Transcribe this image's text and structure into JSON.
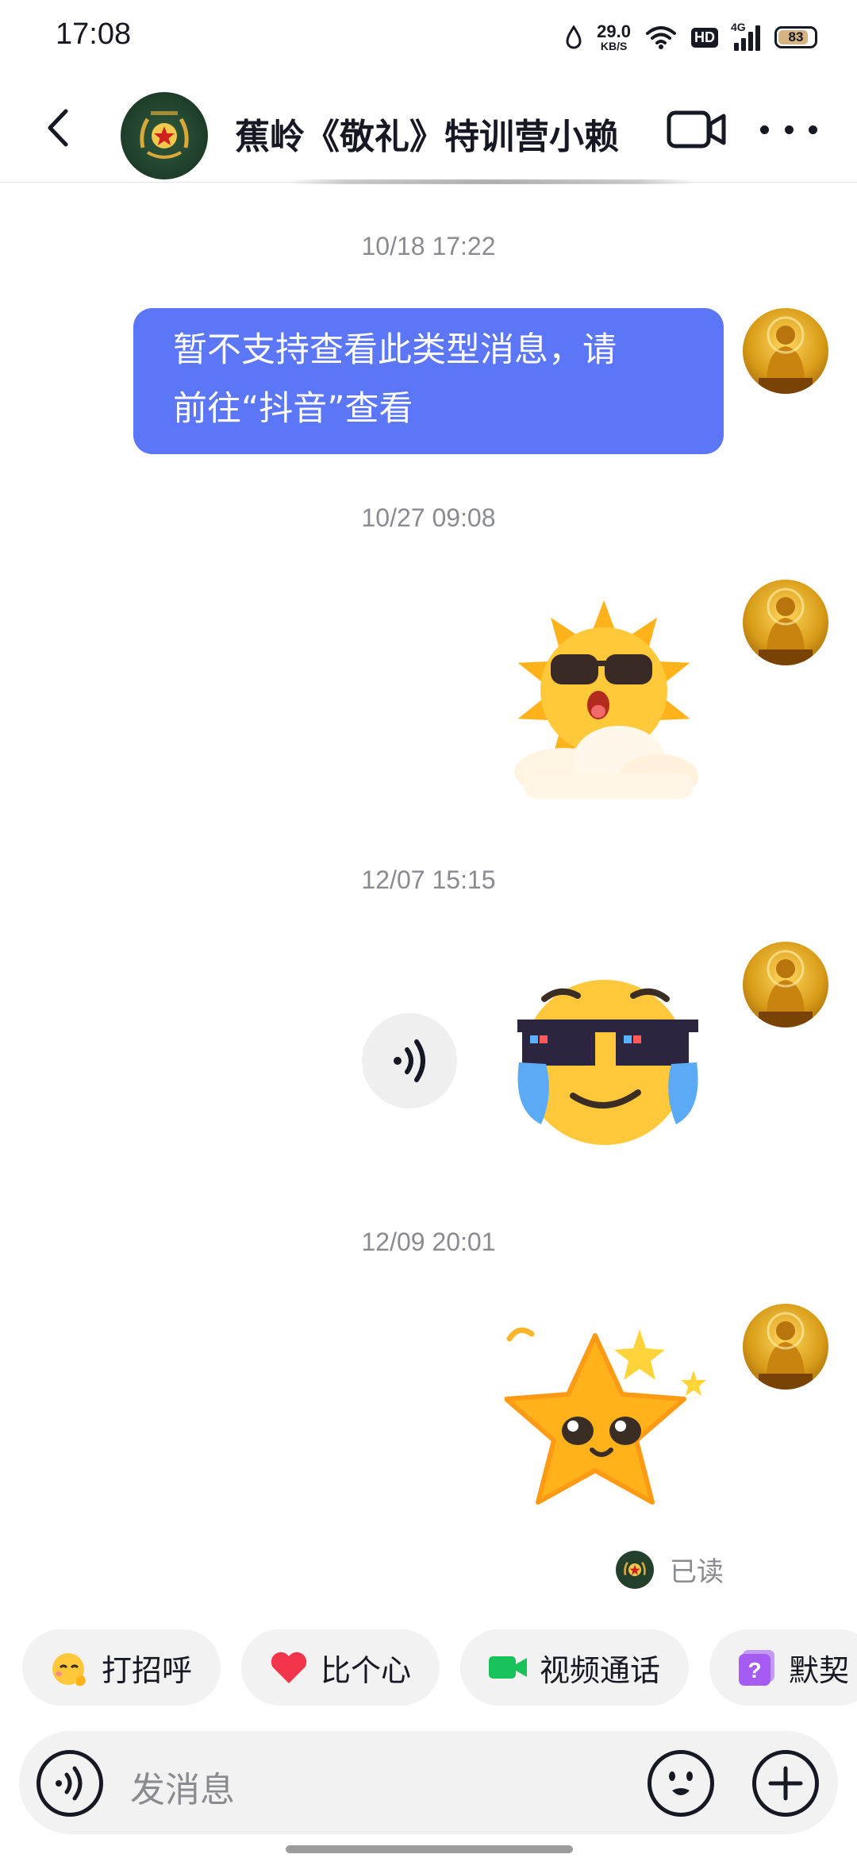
{
  "status_bar": {
    "time": "17:08",
    "net_speed_value": "29.0",
    "net_speed_unit": "KB/S",
    "hd_label": "HD",
    "signal_label": "4G",
    "battery_level": "83"
  },
  "header": {
    "title": "蕉岭《敬礼》特训营小赖",
    "back_icon": "chevron-left-icon",
    "video_icon": "video-camera-icon",
    "more_icon": "more-dots-icon"
  },
  "messages": {
    "ts1": "10/18 17:22",
    "bubble_line1": "暂不支持查看此类型消息，请",
    "bubble_line2": "前往“抖音”查看",
    "ts2": "10/27 09:08",
    "sticker1": "sun-sunglasses-sticker",
    "ts3": "12/07 15:15",
    "sticker2": "crying-cool-face-sticker",
    "ts4": "12/09 20:01",
    "sticker3": "star-sticker",
    "read_status": "已读"
  },
  "quick_replies": [
    {
      "label": "打招呼",
      "icon": "wave-face-icon"
    },
    {
      "label": "比个心",
      "icon": "heart-icon"
    },
    {
      "label": "视频通话",
      "icon": "video-call-icon"
    },
    {
      "label": "默契",
      "icon": "question-icon"
    }
  ],
  "input": {
    "placeholder": "发消息"
  },
  "colors": {
    "bubble": "#5b76f6",
    "accent_green": "#19c35a",
    "accent_purple": "#a45cf2",
    "heart": "#f2354b"
  }
}
